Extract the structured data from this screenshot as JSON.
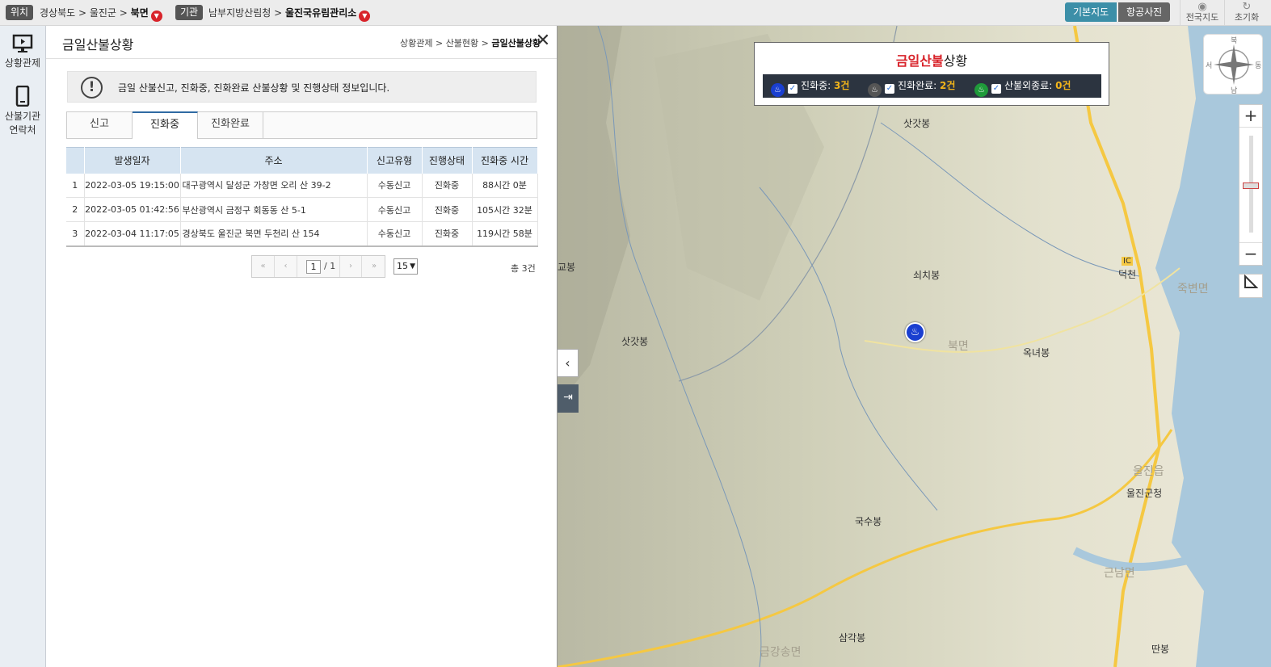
{
  "topbar": {
    "location_tag": "위치",
    "location_path": "경상북도 > 울진군 > ",
    "location_current": "북면",
    "org_tag": "기관",
    "org_path": "남부지방산림청 > ",
    "org_current": "울진국유림관리소",
    "map_base": "기본지도",
    "map_aerial": "항공사진",
    "national_map": "전국지도",
    "reset": "초기화"
  },
  "leftnav": {
    "items": [
      {
        "label": "상황관제"
      },
      {
        "label": "산불기관 연락처"
      }
    ]
  },
  "panel": {
    "title": "금일산불상황",
    "breadcrumb_path": "상황관제 > 산불현황 > ",
    "breadcrumb_current": "금일산불상황",
    "info_text": "금일 산불신고, 진화중, 진화완료 산불상황 및 진행상태 정보입니다.",
    "tabs": [
      "신고",
      "진화중",
      "진화완료"
    ],
    "active_tab": 1,
    "columns": [
      "",
      "발생일자",
      "주소",
      "신고유형",
      "진행상태",
      "진화중 시간"
    ],
    "rows": [
      [
        "1",
        "2022-03-05 19:15:00",
        "대구광역시 달성군 가창면 오리 산 39-2",
        "수동신고",
        "진화중",
        "88시간 0분"
      ],
      [
        "2",
        "2022-03-05 01:42:56",
        "부산광역시 금정구 회동동 산 5-1",
        "수동신고",
        "진화중",
        "105시간 32분"
      ],
      [
        "3",
        "2022-03-04 11:17:05",
        "경상북도 울진군 북면 두천리 산 154",
        "수동신고",
        "진화중",
        "119시간 58분"
      ]
    ],
    "pager": {
      "current": "1",
      "total": "/ 1"
    },
    "page_size": "15",
    "total_count": "총 3건"
  },
  "map": {
    "legend_title_red": "금일산불",
    "legend_title_rest": "상황",
    "legend_items": [
      {
        "label": "진화중: ",
        "count": "3건",
        "color": "#1a3fd0"
      },
      {
        "label": "진화완료: ",
        "count": "2건",
        "color": "#555555"
      },
      {
        "label": "산불외종료: ",
        "count": "0건",
        "color": "#1f9a3a"
      }
    ],
    "places": {
      "p1": "삿갓봉",
      "p2": "쇠치봉",
      "p3": "삿갓봉",
      "p4": "북면",
      "p5": "옥녀봉",
      "p6": "IC",
      "p7": "덕천",
      "p8": "죽변면",
      "p9": "울진읍",
      "p10": "울진군청",
      "p11": "국수봉",
      "p12": "근남면",
      "p13": "삼각봉",
      "p14": "금강송면",
      "p15": "딴봉",
      "p16": "교봉"
    },
    "compass": {
      "n": "북",
      "s": "남",
      "e": "동",
      "w": "서"
    },
    "colors": {
      "water": "#a9c8dc",
      "road": "#f5c842",
      "accent": "#2f6aa3"
    }
  }
}
